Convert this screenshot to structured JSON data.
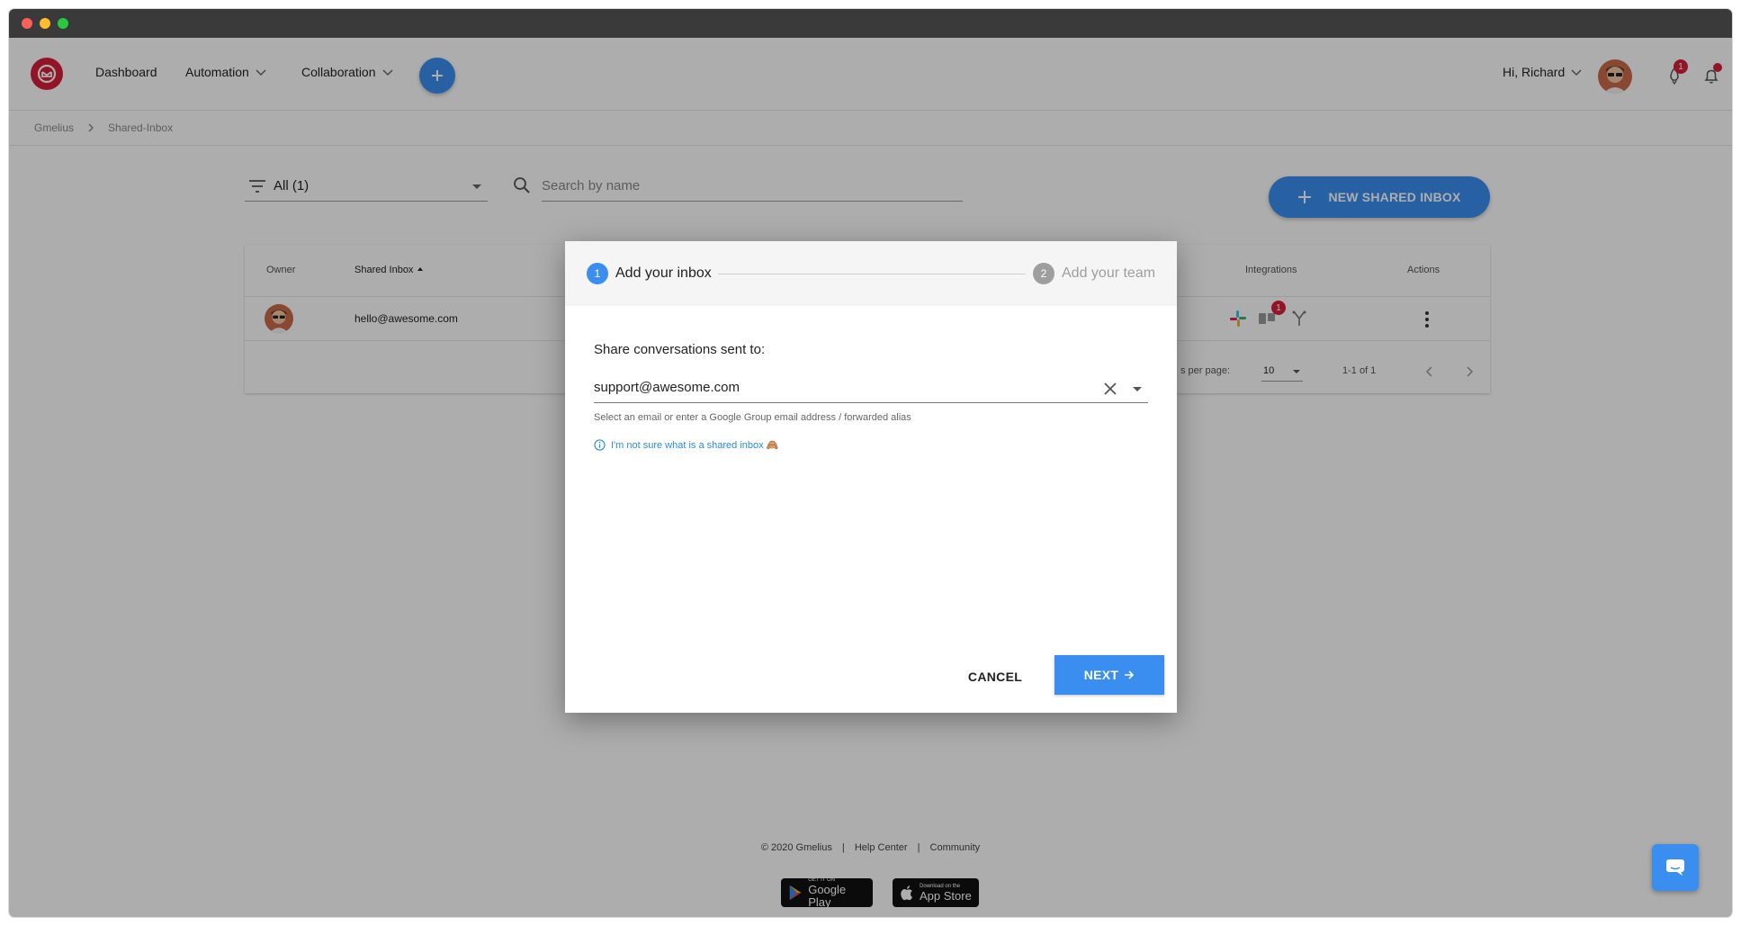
{
  "header": {
    "nav": [
      {
        "label": "Dashboard"
      },
      {
        "label": "Automation"
      },
      {
        "label": "Collaboration"
      }
    ],
    "greeting": "Hi, Richard",
    "notification_badge": "1"
  },
  "breadcrumb": [
    "Gmelius",
    "Shared-Inbox"
  ],
  "toolbar": {
    "filter_value": "All (1)",
    "search_placeholder": "Search by name",
    "new_button_label": "NEW SHARED INBOX"
  },
  "table": {
    "columns": {
      "owner": "Owner",
      "shared_inbox": "Shared Inbox",
      "integrations": "Integrations",
      "actions": "Actions"
    },
    "rows": [
      {
        "email": "hello@awesome.com",
        "integration_badge": "1"
      }
    ],
    "pager": {
      "rows_per_page_label": "s per page:",
      "rows_per_page_value": "10",
      "range": "1-1 of 1"
    }
  },
  "dialog": {
    "steps": [
      {
        "number": "1",
        "label": "Add your inbox"
      },
      {
        "number": "2",
        "label": "Add your team"
      }
    ],
    "prompt": "Share conversations sent to:",
    "email_value": "support@awesome.com",
    "helper_text": "Select an email or enter a Google Group email address / forwarded alias",
    "info_link": "I'm not sure what is a shared inbox 🙈",
    "cancel_label": "CANCEL",
    "next_label": "NEXT"
  },
  "footer": {
    "copyright": "© 2020 Gmelius",
    "separator": "|",
    "help": "Help Center",
    "community": "Community",
    "google_play_small": "GET IT ON",
    "google_play_big": "Google Play",
    "app_store_small": "Download on the",
    "app_store_big": "App Store"
  },
  "colors": {
    "accent": "#3a8ef0",
    "brand": "#d8203a",
    "link": "#2a8be0"
  }
}
